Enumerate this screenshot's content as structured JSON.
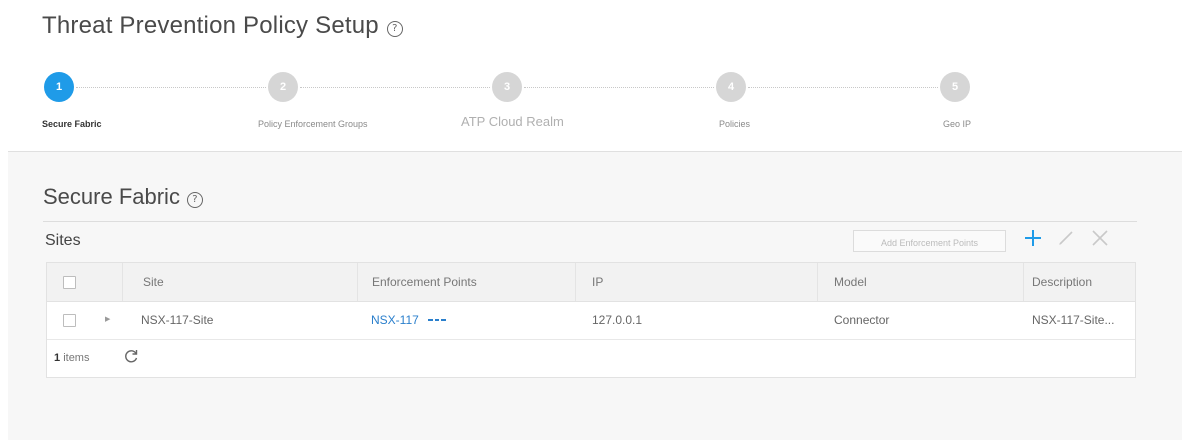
{
  "page": {
    "title": "Threat Prevention Policy Setup",
    "help_symbol": "?"
  },
  "wizard": {
    "steps": [
      {
        "number": "1",
        "label": "Secure Fabric",
        "active": true
      },
      {
        "number": "2",
        "label": "Policy Enforcement Groups",
        "active": false
      },
      {
        "number": "3",
        "label": "ATP Cloud Realm",
        "active": false
      },
      {
        "number": "4",
        "label": "Policies",
        "active": false
      },
      {
        "number": "5",
        "label": "Geo IP",
        "active": false
      }
    ],
    "colors": {
      "active": "#1f9be8",
      "inactive": "#d6d6d6"
    }
  },
  "section": {
    "title": "Secure Fabric",
    "help_symbol": "?"
  },
  "sites": {
    "title": "Sites",
    "add_button_label": "Add Enforcement Points",
    "toolbar_icons": [
      "plus-icon",
      "pencil-icon",
      "close-icon"
    ],
    "columns": [
      "Site",
      "Enforcement Points",
      "IP",
      "Model",
      "Description"
    ],
    "rows": [
      {
        "site": "NSX-117-Site",
        "enforcement_point": "NSX-117",
        "ip": "127.0.0.1",
        "model": "Connector",
        "description": "NSX-117-Site..."
      }
    ],
    "footer": {
      "count": "1",
      "count_label": "items"
    }
  },
  "colors": {
    "accent": "#1f9be8",
    "link": "#2a7fcc"
  }
}
